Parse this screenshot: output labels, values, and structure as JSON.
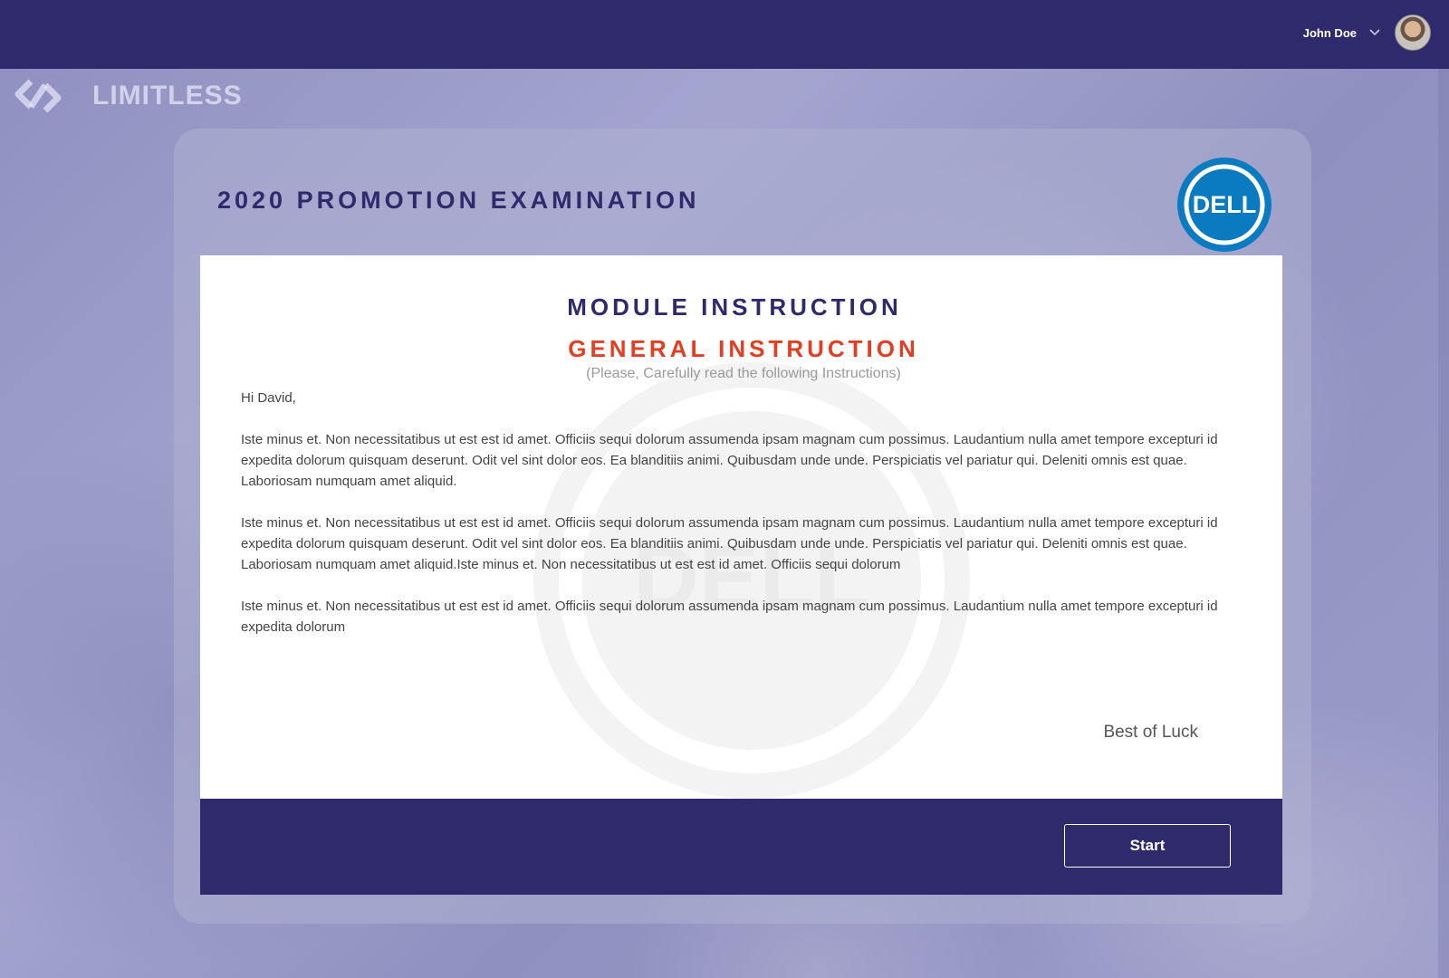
{
  "header": {
    "user_name": "John Doe"
  },
  "brand": {
    "name": "LIMITLESS"
  },
  "exam": {
    "title": "2020 PROMOTION EXAMINATION",
    "logo_text": "DELL"
  },
  "instructions": {
    "module_title": "MODULE INSTRUCTION",
    "general_title": "GENERAL INSTRUCTION",
    "subtitle": "(Please, Carefully read the following Instructions)",
    "greeting": "Hi David,",
    "paragraphs": [
      "Iste minus et. Non necessitatibus ut est est id amet. Officiis sequi dolorum assumenda ipsam magnam cum possimus. Laudantium nulla amet tempore excepturi id expedita dolorum quisquam deserunt. Odit vel sint dolor eos. Ea blanditiis animi. Quibusdam unde unde. Perspiciatis vel pariatur qui. Deleniti omnis est quae. Laboriosam numquam amet aliquid.",
      "Iste minus et. Non necessitatibus ut est est id amet. Officiis sequi dolorum assumenda ipsam magnam cum possimus. Laudantium nulla amet tempore excepturi id expedita dolorum quisquam deserunt. Odit vel sint dolor eos. Ea blanditiis animi. Quibusdam unde unde. Perspiciatis vel pariatur qui. Deleniti omnis est quae. Laboriosam numquam amet aliquid.Iste minus et. Non necessitatibus ut est est id amet. Officiis sequi dolorum",
      "Iste minus et. Non necessitatibus ut est est id amet. Officiis sequi dolorum assumenda ipsam magnam cum possimus. Laudantium nulla amet tempore excepturi id expedita dolorum"
    ],
    "closing": "Best of Luck"
  },
  "actions": {
    "start_label": "Start"
  },
  "colors": {
    "primary": "#2e2a6b",
    "accent": "#e33e22",
    "dell_blue": "#0a7bc1"
  },
  "icons": {
    "user_menu": "chevron-down-icon",
    "brand": "limitless-logo-icon",
    "exam_logo": "dell-logo-icon"
  }
}
